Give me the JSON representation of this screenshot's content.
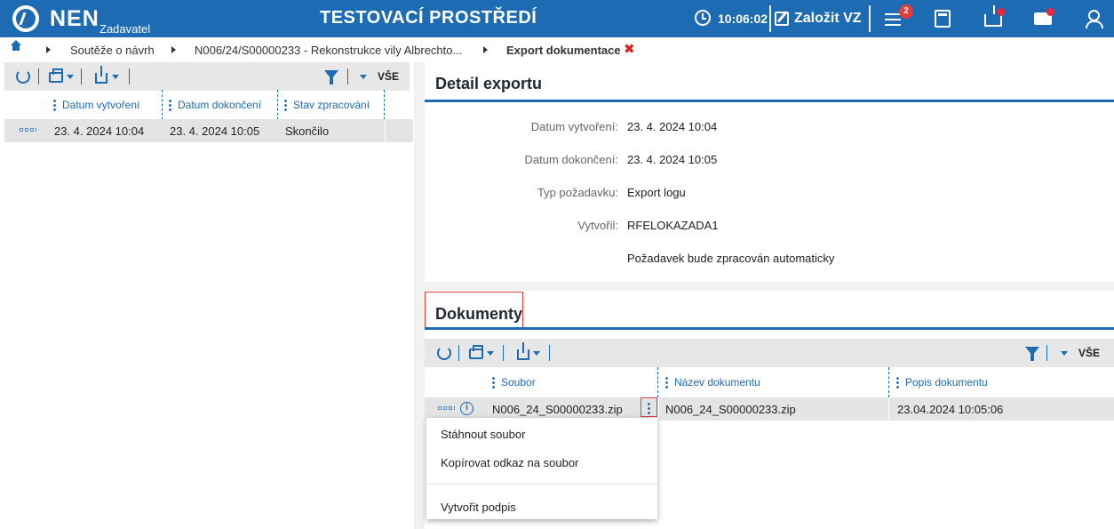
{
  "header": {
    "logo": "NEN",
    "logo_sub": "Zadavatel",
    "env_title": "TESTOVACÍ PROSTŘEDÍ",
    "time": "10:06:02",
    "create_label": "Založit VZ",
    "menu_badge": "2"
  },
  "breadcrumb": {
    "items": [
      "Soutěže o návrh",
      "N006/24/S00000233 - Rekonstrukce vily Albrechto..."
    ],
    "current": "Export dokumentace",
    "close": "✖"
  },
  "left_table": {
    "filter_label": "VŠE",
    "columns": [
      "Datum vytvoření",
      "Datum dokončení",
      "Stav zpracování"
    ],
    "rows": [
      {
        "created": "23. 4. 2024 10:04",
        "finished": "23. 4. 2024 10:05",
        "status": "Skončilo"
      }
    ]
  },
  "detail": {
    "title": "Detail exportu",
    "fields": [
      {
        "label": "Datum vytvoření:",
        "value": "23. 4. 2024 10:04"
      },
      {
        "label": "Datum dokončení:",
        "value": "23. 4. 2024 10:05"
      },
      {
        "label": "Typ požadavku:",
        "value": "Export logu"
      },
      {
        "label": "Vytvořil:",
        "value": "RFELOKAZADA1"
      }
    ],
    "note": "Požadavek bude zpracován automaticky"
  },
  "documents": {
    "title": "Dokumenty",
    "filter_label": "VŠE",
    "columns": [
      "Soubor",
      "Název dokumentu",
      "Popis dokumentu"
    ],
    "rows": [
      {
        "file": "N006_24_S00000233.zip",
        "name": "N006_24_S00000233.zip",
        "description": "23.04.2024 10:05:06"
      }
    ]
  },
  "context_menu": {
    "items": [
      "Stáhnout soubor",
      "Kopírovat odkaz na soubor",
      "Vytvořit podpis"
    ]
  },
  "colors": {
    "brand": "#1d6bb3",
    "alert": "#e23c3c"
  }
}
